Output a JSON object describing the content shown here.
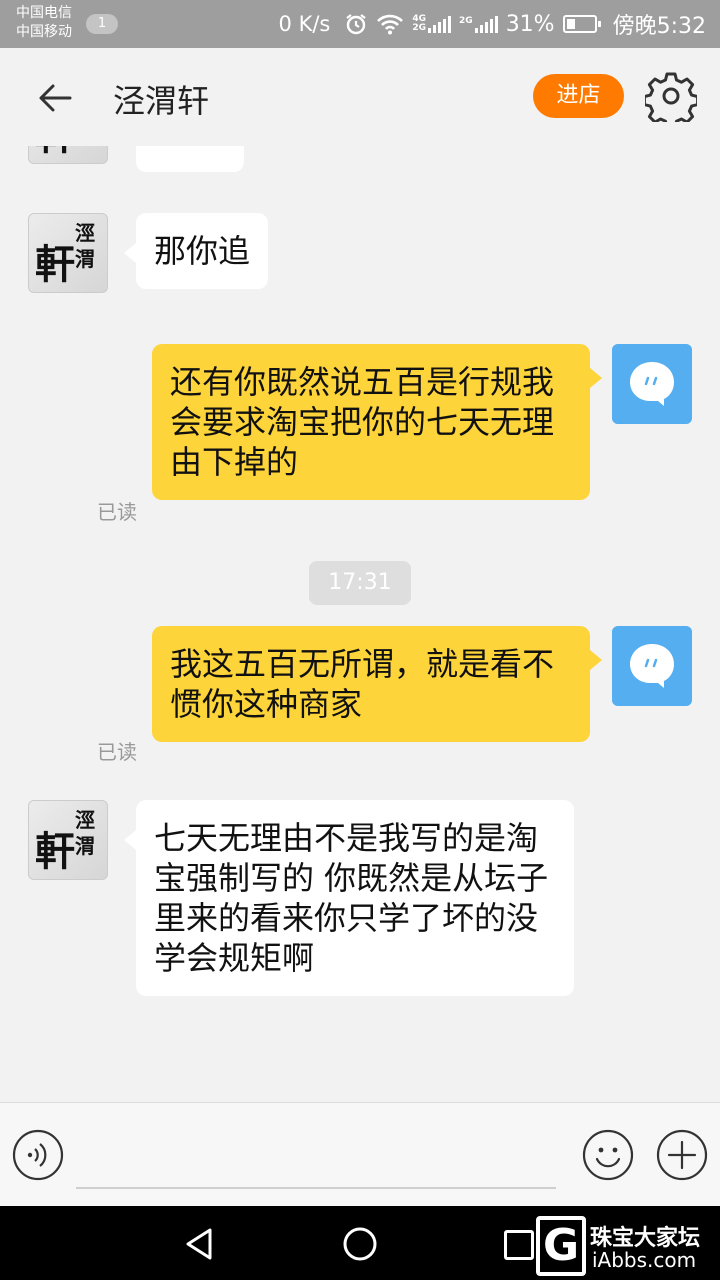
{
  "status_bar": {
    "carrier1": "中国电信",
    "carrier2": "中国移动",
    "sim_badge": "1",
    "speed": "0 K/s",
    "net1": "4G",
    "net2": "2G",
    "net3": "2G",
    "battery": "31%",
    "time": "傍晚5:32"
  },
  "header": {
    "title": "泾渭轩",
    "enter_label": "进店",
    "icons": {
      "back": "back-arrow-icon",
      "settings": "gear-icon"
    }
  },
  "shop_avatar": {
    "glyph_big": "軒",
    "glyph_small": "涇渭"
  },
  "messages": [
    {
      "side": "in",
      "text": "那你追"
    },
    {
      "side": "out",
      "text": "还有你既然说五百是行规我会要求淘宝把你的七天无理由下掉的",
      "status": "已读"
    },
    {
      "side": "time",
      "text": "17:31"
    },
    {
      "side": "out",
      "text": "我这五百无所谓，就是看不惯你这种商家",
      "status": "已读"
    },
    {
      "side": "in",
      "text": "七天无理由不是我写的是淘宝强制写的 你既然是从坛子里来的看来你只学了坏的没学会规矩啊"
    }
  ],
  "input_bar": {
    "icons": {
      "voice": "voice-icon",
      "emoji": "emoji-icon",
      "plus": "plus-icon"
    }
  },
  "watermark": {
    "letter": "G",
    "line1": "珠宝大家坛",
    "line2": "iAbbs.com"
  },
  "colors": {
    "accent": "#ff7a00",
    "out_bubble": "#fdd43a",
    "in_bubble": "#ffffff",
    "user_avatar": "#54aef0",
    "background": "#f2f2f2"
  }
}
